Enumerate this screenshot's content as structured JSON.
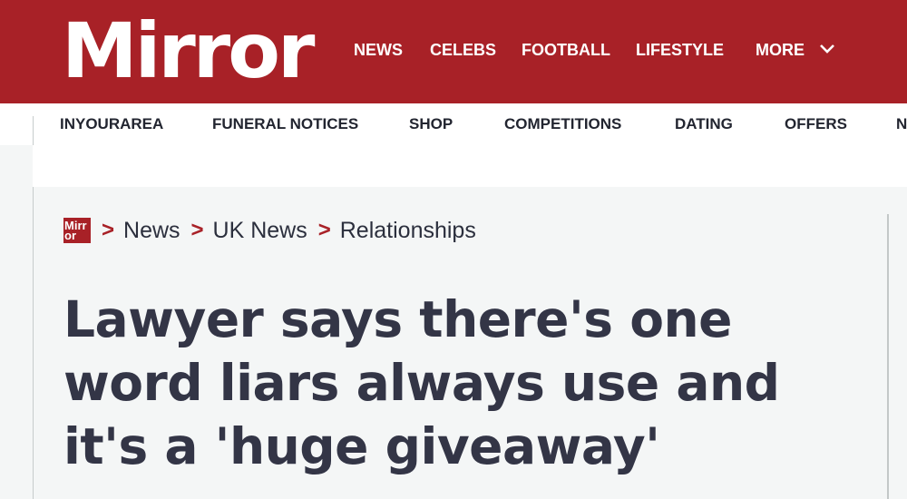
{
  "header": {
    "logo": "Mirror",
    "primary_nav": [
      "NEWS",
      "CELEBS",
      "FOOTBALL",
      "LIFESTYLE"
    ],
    "more_label": "MORE"
  },
  "secondary_nav": [
    "INYOURAREA",
    "FUNERAL NOTICES",
    "SHOP",
    "COMPETITIONS",
    "DATING",
    "OFFERS",
    "N"
  ],
  "breadcrumb": {
    "logo": "Mirr or",
    "items": [
      "News",
      "UK News",
      "Relationships"
    ],
    "separator": ">"
  },
  "article": {
    "headline": "Lawyer says there's one word liars always use and it's a 'huge giveaway'"
  },
  "colors": {
    "brand_red": "#a82127",
    "headline": "#333546",
    "page_bg": "#f4f6f6"
  }
}
